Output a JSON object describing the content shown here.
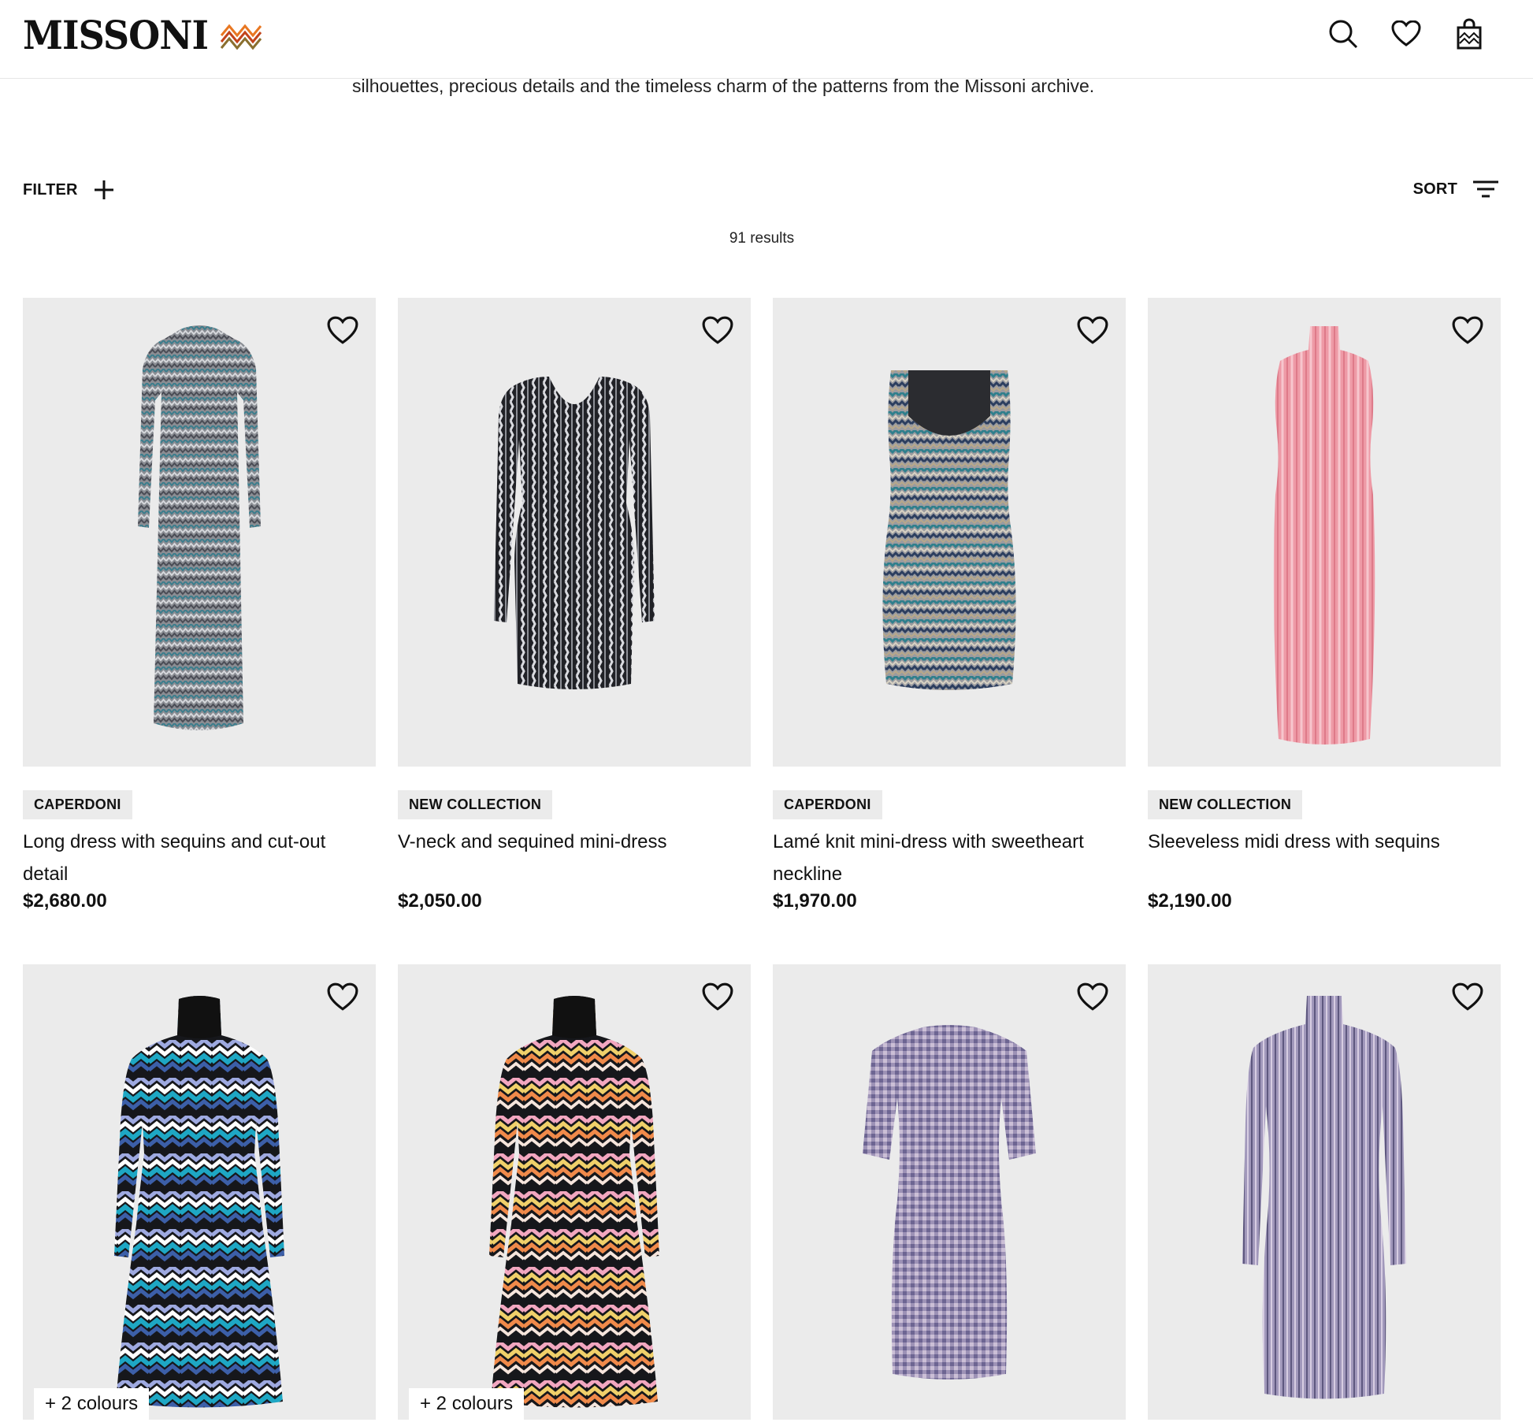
{
  "brand": {
    "name": "MISSONI"
  },
  "header": {
    "icons": [
      "search-icon",
      "heart-icon",
      "shopping-bag-icon"
    ]
  },
  "intro": "silhouettes, precious details and the timeless charm of the patterns from the Missoni archive.",
  "toolbar": {
    "filter_label": "FILTER",
    "sort_label": "SORT"
  },
  "results": "91 results",
  "products": [
    {
      "badge": "CAPERDONI",
      "name": "Long dress with sequins and cut-out detail",
      "price": "$2,680.00"
    },
    {
      "badge": "NEW COLLECTION",
      "name": "V-neck and sequined mini-dress",
      "price": "$2,050.00"
    },
    {
      "badge": "CAPERDONI",
      "name": "Lamé knit mini-dress with sweetheart neckline",
      "price": "$1,970.00"
    },
    {
      "badge": "NEW COLLECTION",
      "name": "Sleeveless midi dress with sequins",
      "price": "$2,190.00"
    },
    {
      "colours": "+ 2 colours"
    },
    {
      "colours": "+ 2 colours"
    },
    {},
    {}
  ],
  "colors": {
    "image_bg": "#ebebeb",
    "badge_bg": "#ebebeb",
    "text": "#111111"
  }
}
